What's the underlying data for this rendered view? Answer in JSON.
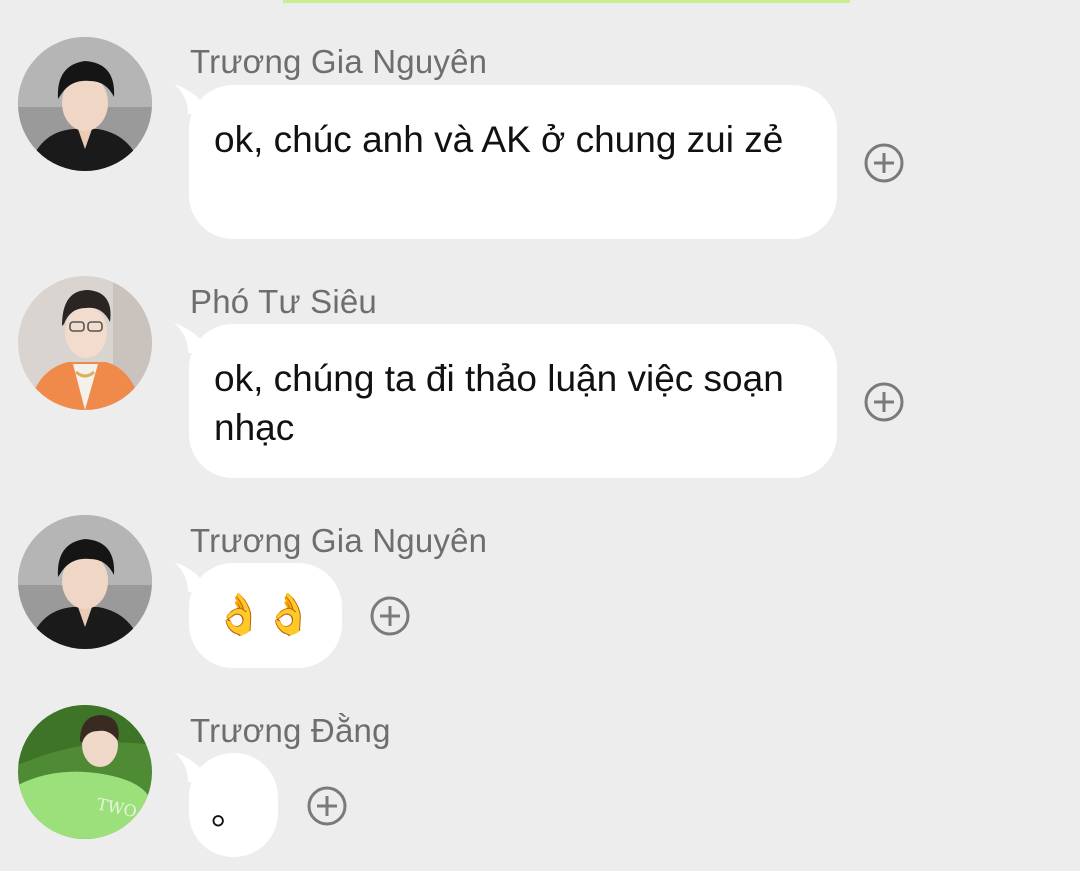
{
  "colors": {
    "background": "#ededed",
    "bubble": "#ffffff",
    "sender_name": "#6e6e6e",
    "accent_bar": "#c8ef8f",
    "icon": "#7a7a7a"
  },
  "messages": [
    {
      "sender": "Trương Gia Nguyên",
      "text": "ok, chúc anh và AK ở chung zui zẻ",
      "reaction_icon": "add-reaction-icon"
    },
    {
      "sender": "Phó Tư Siêu",
      "text": "ok, chúng ta đi thảo luận việc soạn nhạc",
      "reaction_icon": "add-reaction-icon"
    },
    {
      "sender": "Trương Gia Nguyên",
      "text": "👌👌",
      "reaction_icon": "add-reaction-icon"
    },
    {
      "sender": "Trương Đằng",
      "text": "。",
      "reaction_icon": "add-reaction-icon"
    }
  ]
}
